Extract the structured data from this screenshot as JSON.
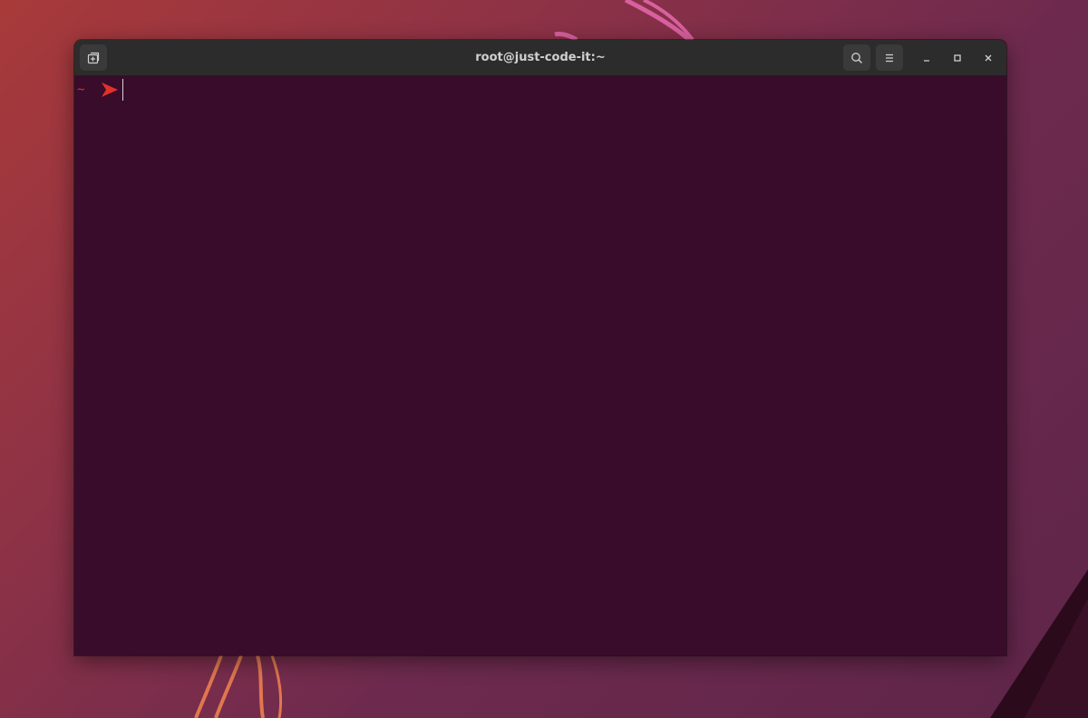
{
  "window": {
    "title": "root@just-code-it:~"
  },
  "header": {
    "new_tab_icon": "new-tab-icon",
    "search_icon": "search-icon",
    "menu_icon": "hamburger-menu-icon",
    "minimize_icon": "minimize-icon",
    "maximize_icon": "maximize-icon",
    "close_icon": "close-icon"
  },
  "terminal": {
    "prompt_dir": "~",
    "prompt_symbol_icon": "prompt-arrow-icon",
    "command": "",
    "colors": {
      "background": "#380c2a",
      "prompt": "#e0322b",
      "cursor": "#d8d8d8"
    }
  }
}
